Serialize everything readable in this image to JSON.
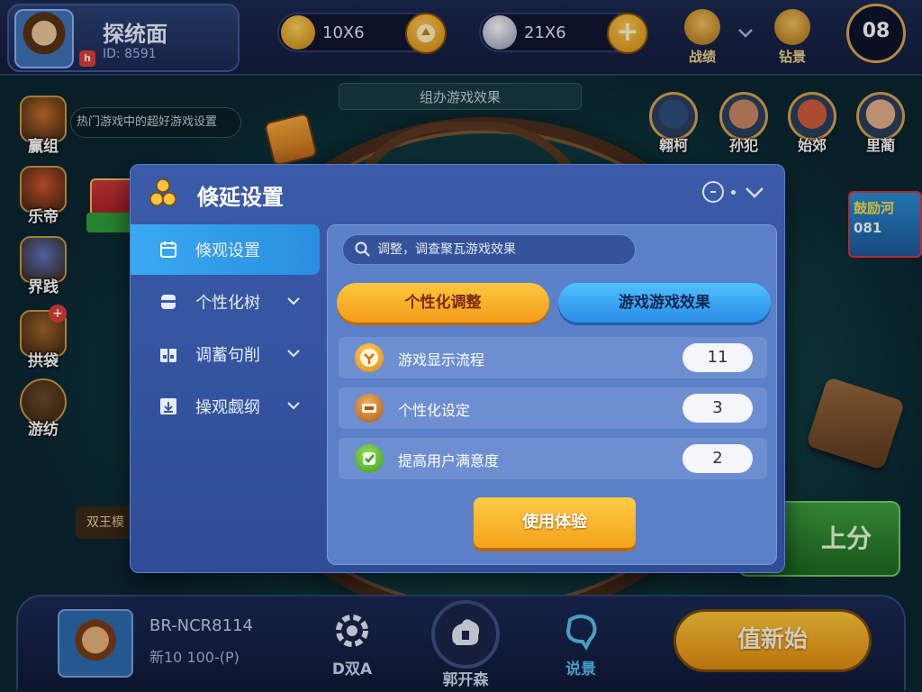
{
  "background": {
    "table_sign": "组办游戏效果",
    "tag_text": "热门游戏中的超好游戏设置",
    "left_label": "双王模",
    "right_button": "上分",
    "right_card_line1": "鼓励河",
    "right_card_line2": "081"
  },
  "topbar": {
    "profile_name": "探统面",
    "profile_id": "ID: 8591",
    "avatar_badge": "h",
    "currency_gold": "10X6",
    "currency_diamond": "21X6",
    "plus": "+",
    "icon1_label": "战绩",
    "icon2_label": "钻景",
    "menu_label": "08"
  },
  "side_icons": [
    {
      "label": "赢组",
      "color": "#c9702a",
      "badge": ""
    },
    {
      "label": "乐帝",
      "color": "#d4572a",
      "badge": ""
    },
    {
      "label": "界践",
      "color": "#5d77c4",
      "badge": ""
    },
    {
      "label": "拱袋",
      "color": "#a5682a",
      "badge": "+"
    },
    {
      "label": "游纺",
      "color": "#6b4a2a",
      "badge": ""
    }
  ],
  "players": [
    {
      "label": "翱柯",
      "color": "#2c4f7a"
    },
    {
      "label": "孙犯",
      "color": "#c98a62"
    },
    {
      "label": "始郊",
      "color": "#d05d3b"
    },
    {
      "label": "里蔺",
      "color": "#e3b08a"
    }
  ],
  "bottombar": {
    "name": "BR-NCR8114",
    "sub": "新10 100-(P)",
    "btn1": "D双A",
    "btn2": "郭开森",
    "btn3": "说景",
    "play": "值新始"
  },
  "modal": {
    "title": "倏延设置",
    "sidebar": [
      {
        "label": "倏观设置",
        "icon": "settings-icon",
        "active": true
      },
      {
        "label": "个性化树",
        "icon": "profile-icon",
        "active": false
      },
      {
        "label": "调蓄句削",
        "icon": "gift-icon",
        "active": false
      },
      {
        "label": "操观觑纲",
        "icon": "download-icon",
        "active": false
      }
    ],
    "search": {
      "placeholder": "调整，调查聚瓦游戏效果"
    },
    "tabs": {
      "personalize": "个性化调整",
      "game_effect": "游戏游戏效果"
    },
    "rows": [
      {
        "label": "游戏显示流程",
        "value": "11",
        "icon_color": "#f3a623"
      },
      {
        "label": "个性化设定",
        "value": "3",
        "icon_color": "#d67a2a"
      },
      {
        "label": "提高用户满意度",
        "value": "2",
        "icon_color": "#58b82e"
      }
    ],
    "use_button": "使用体验"
  }
}
